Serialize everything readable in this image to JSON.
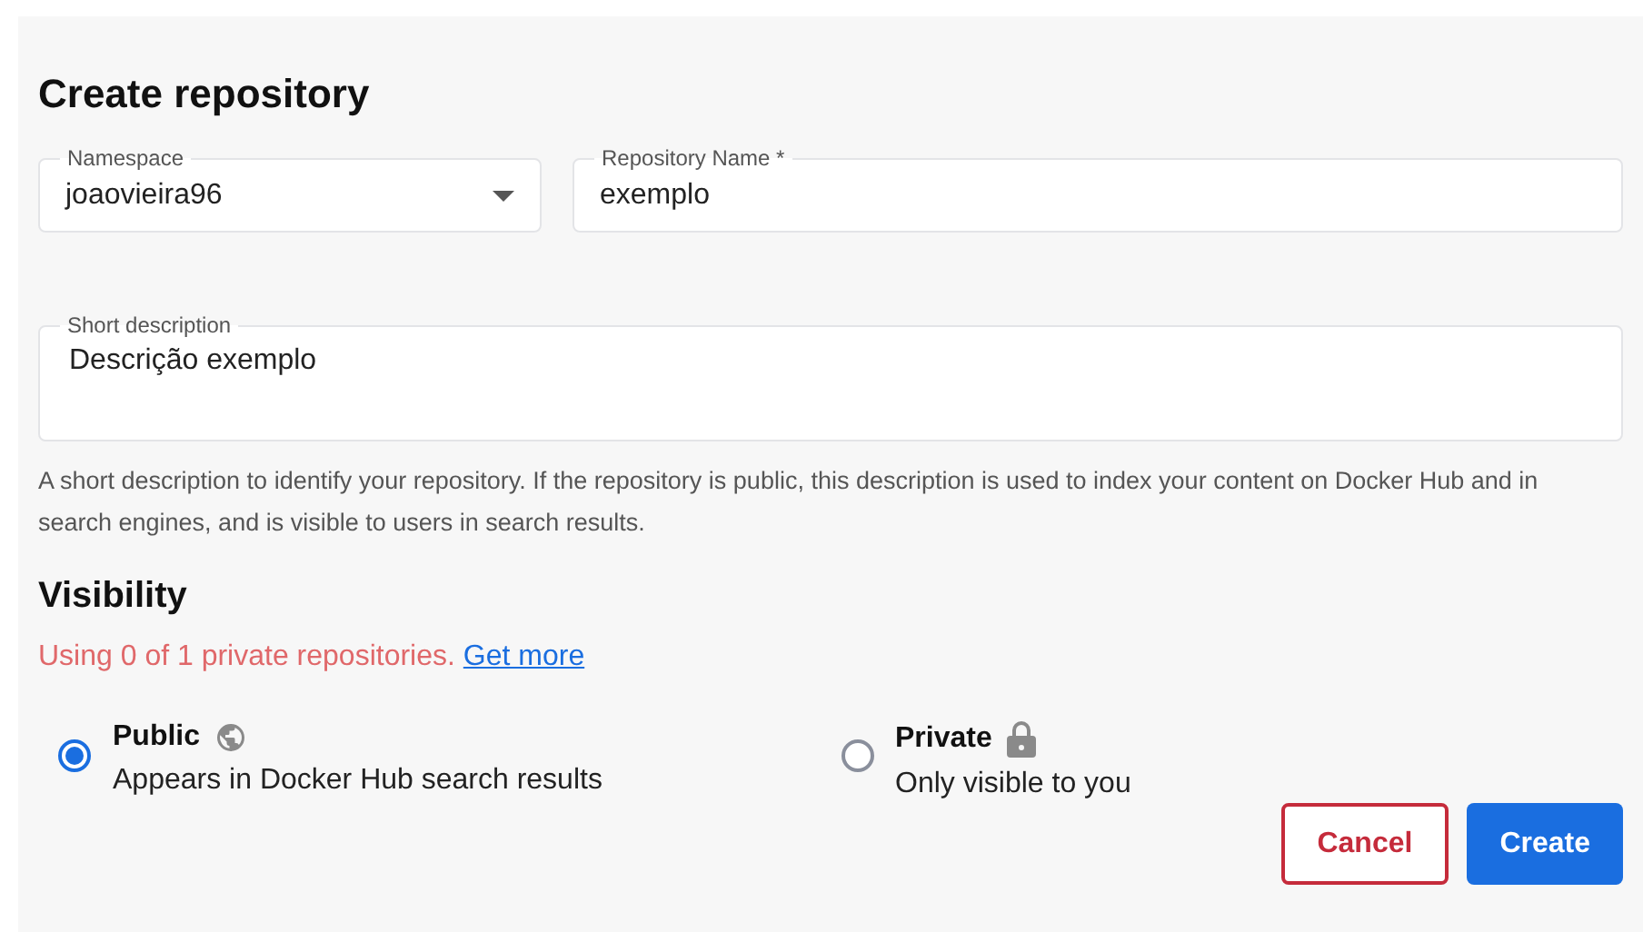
{
  "title": "Create repository",
  "fields": [
    {
      "kind": "select",
      "label": "Namespace",
      "value": "joaovieira96"
    },
    {
      "kind": "text",
      "label": "Repository Name *",
      "value": "exemplo"
    }
  ],
  "description": {
    "label": "Short description",
    "value": "Descrição exemplo",
    "help": "A short description to identify your repository. If the repository is public, this description is used to index your content on Docker Hub and in search engines, and is visible to users in search results."
  },
  "visibility": {
    "heading": "Visibility",
    "usage": "Using 0 of 1 private repositories.",
    "link": "Get more",
    "options": [
      {
        "kind": "globe",
        "label": "Public",
        "hint": "Appears in Docker Hub search results",
        "selected": true
      },
      {
        "kind": "lock",
        "label": "Private",
        "hint": "Only visible to you",
        "selected": false
      }
    ]
  },
  "buttons": [
    {
      "kind": "secondary",
      "label": "Cancel"
    },
    {
      "kind": "primary",
      "label": "Create"
    }
  ]
}
